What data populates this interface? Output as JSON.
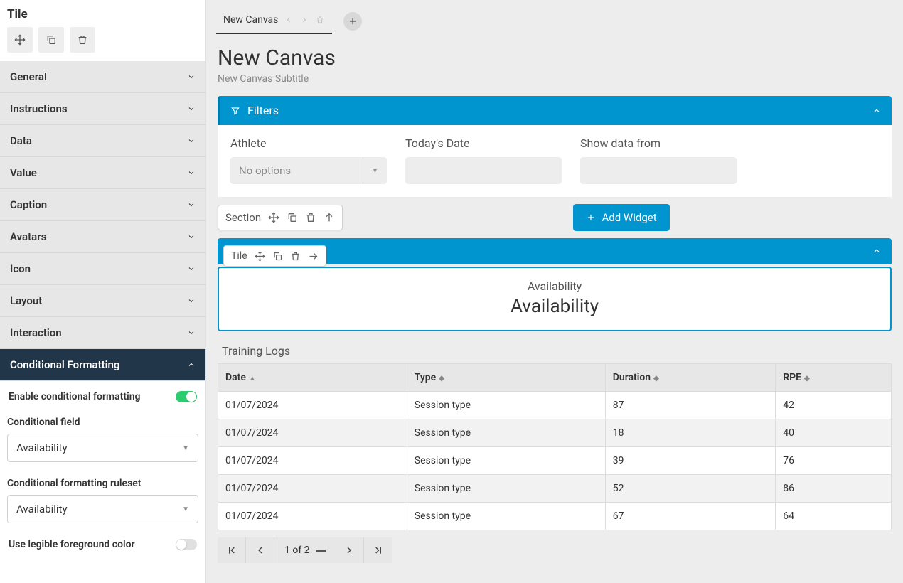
{
  "sidebar": {
    "title": "Tile",
    "sections": [
      "General",
      "Instructions",
      "Data",
      "Value",
      "Caption",
      "Avatars",
      "Icon",
      "Layout",
      "Interaction"
    ],
    "active_section": "Conditional Formatting",
    "cond_formatting": {
      "enable_label": "Enable conditional formatting",
      "enable_value": true,
      "field_label": "Conditional field",
      "field_value": "Availability",
      "ruleset_label": "Conditional formatting ruleset",
      "ruleset_value": "Availability",
      "legible_label": "Use legible foreground color",
      "legible_value": false
    }
  },
  "tabs": {
    "active": "New Canvas"
  },
  "canvas": {
    "title": "New Canvas",
    "subtitle": "New Canvas Subtitle"
  },
  "filters": {
    "header": "Filters",
    "fields": {
      "athlete": {
        "label": "Athlete",
        "placeholder": "No options"
      },
      "date": {
        "label": "Today's Date"
      },
      "show_from": {
        "label": "Show data from"
      }
    }
  },
  "section_toolbar": {
    "label": "Section"
  },
  "add_widget_label": "Add Widget",
  "tile_toolbar": {
    "label": "Tile"
  },
  "tile": {
    "caption": "Availability",
    "value": "Availability"
  },
  "table": {
    "title": "Training Logs",
    "headers": [
      "Date",
      "Type",
      "Duration",
      "RPE"
    ],
    "rows": [
      {
        "date": "01/07/2024",
        "type": "Session type",
        "duration": "87",
        "rpe": "42"
      },
      {
        "date": "01/07/2024",
        "type": "Session type",
        "duration": "18",
        "rpe": "40"
      },
      {
        "date": "01/07/2024",
        "type": "Session type",
        "duration": "39",
        "rpe": "76"
      },
      {
        "date": "01/07/2024",
        "type": "Session type",
        "duration": "52",
        "rpe": "86"
      },
      {
        "date": "01/07/2024",
        "type": "Session type",
        "duration": "67",
        "rpe": "64"
      }
    ]
  },
  "pager": {
    "text": "1 of 2"
  }
}
